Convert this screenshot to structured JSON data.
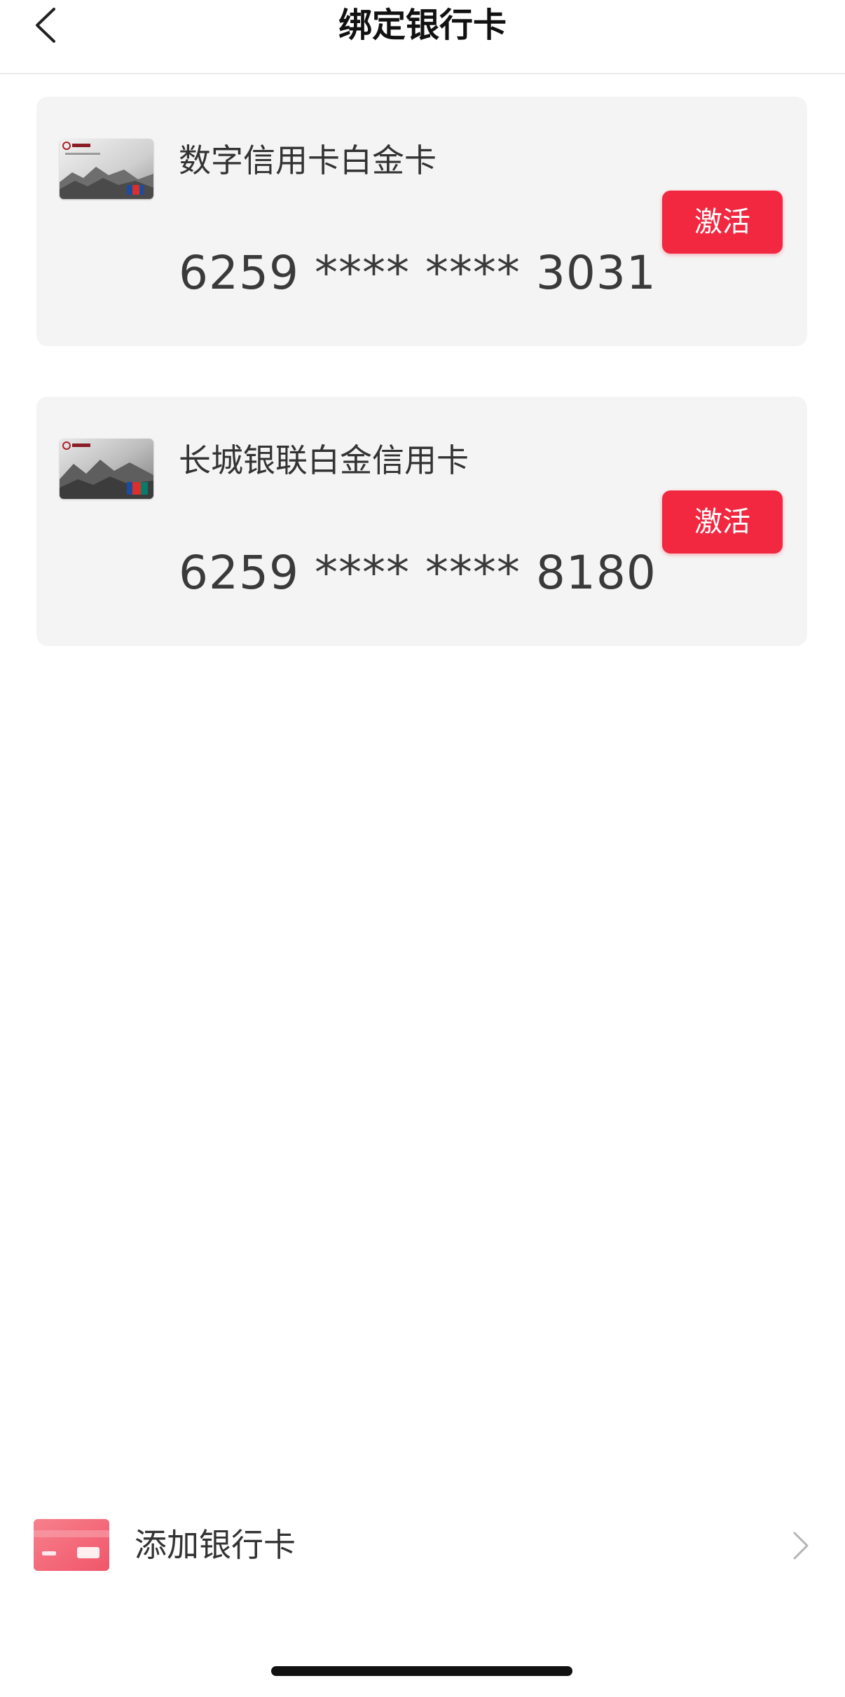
{
  "header": {
    "title": "绑定银行卡",
    "back_icon": "chevron-left-icon"
  },
  "cards": [
    {
      "name": "数字信用卡白金卡",
      "number": "6259 **** **** 3031",
      "action_label": "激活",
      "thumbnail_icon": "credit-card-image"
    },
    {
      "name": "长城银联白金信用卡",
      "number": "6259 **** **** 8180",
      "action_label": "激活",
      "thumbnail_icon": "credit-card-image"
    }
  ],
  "add_card": {
    "label": "添加银行卡",
    "icon": "bank-card-icon",
    "arrow_icon": "chevron-right-icon"
  },
  "colors": {
    "accent": "#f22740",
    "card_background": "#f4f4f4",
    "add_icon": "#f36a78"
  }
}
